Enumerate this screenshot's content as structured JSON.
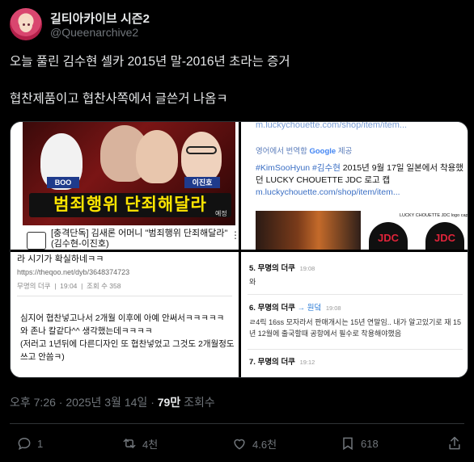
{
  "author": {
    "display_name": "길티아카이브 시즌2",
    "handle": "@Queenarchive2"
  },
  "tweet": {
    "line1": "오늘 풀린 김수현 셀카 2015년 말-2016년 초라는 증거",
    "line2": "협찬제품이고 협찬사쪽에서 글쓴거 나옴ㅋ"
  },
  "media": {
    "video": {
      "tag_left": "BOO",
      "tag_right": "이진호",
      "banner": "범죄행위 단죄해달라",
      "banner_sub": "예정",
      "title": "[충격단독] 김새론 어머니 \"범죄행위 단죄해달라\" (김수현-이진호)"
    },
    "post": {
      "url_top": "m.luckychouette.com/shop/item/item...",
      "translate_prefix": "영어에서 번역함",
      "translate_brand": "Google",
      "translate_suffix": "제공",
      "hashtags": "#KimSooHyun #김수현",
      "body": "2015년 9월 17일 일본에서 착용했던 LUCKY CHOUETTE JDC 로고 캡",
      "url": "m.luckychouette.com/shop/item/item...",
      "cap_label": "LUCKY CHOUETTE JDC logo cap",
      "cap_text": "JDC"
    },
    "board": {
      "line1": "라 시기가 확실하네ㅋㅋ",
      "url": "https://theqoo.net/dyb/3648374723",
      "author": "무명의 더쿠",
      "time": "19:04",
      "views": "조회 수 358",
      "body1": "심지어 협찬넣고나서 2개월 이후에 아예 안써서ㅋㅋㅋㅋㅋ",
      "body2": "와 존나 칼같다^^ 생각했는데ㅋㅋㅋㅋ",
      "body3": "(저러고 1년뒤에 다른디자인 또 협찬넣었고 그것도 2개월정도 쓰고 안씀ㅋ)"
    },
    "comments": [
      {
        "num": "5.",
        "author": "무명의 더쿠",
        "time": "19:08",
        "sub": "",
        "body": "와"
      },
      {
        "num": "6.",
        "author": "무명의 더쿠",
        "time": "19:08",
        "sub": "→ 원덬",
        "body": "ㄹ4릭 16ss 모자라서 판매개시는 15년 연말임.. 내가 알고있기로 재 15년 12월에 출국할때 공항에서 필수로 착용해야했음"
      },
      {
        "num": "7.",
        "author": "무명의 더쿠",
        "time": "19:12",
        "sub": "",
        "body": ""
      }
    ]
  },
  "meta": {
    "time": "오후 7:26",
    "dot": "·",
    "date": "2025년 3월 14일",
    "views": "79만",
    "views_label": "조회수"
  },
  "actions": {
    "reply_count": "1",
    "retweet_count": "4천",
    "like_count": "4.6천",
    "bookmark_count": "618"
  },
  "icons": [
    "reply-icon",
    "retweet-icon",
    "like-icon",
    "bookmark-icon",
    "share-icon"
  ]
}
